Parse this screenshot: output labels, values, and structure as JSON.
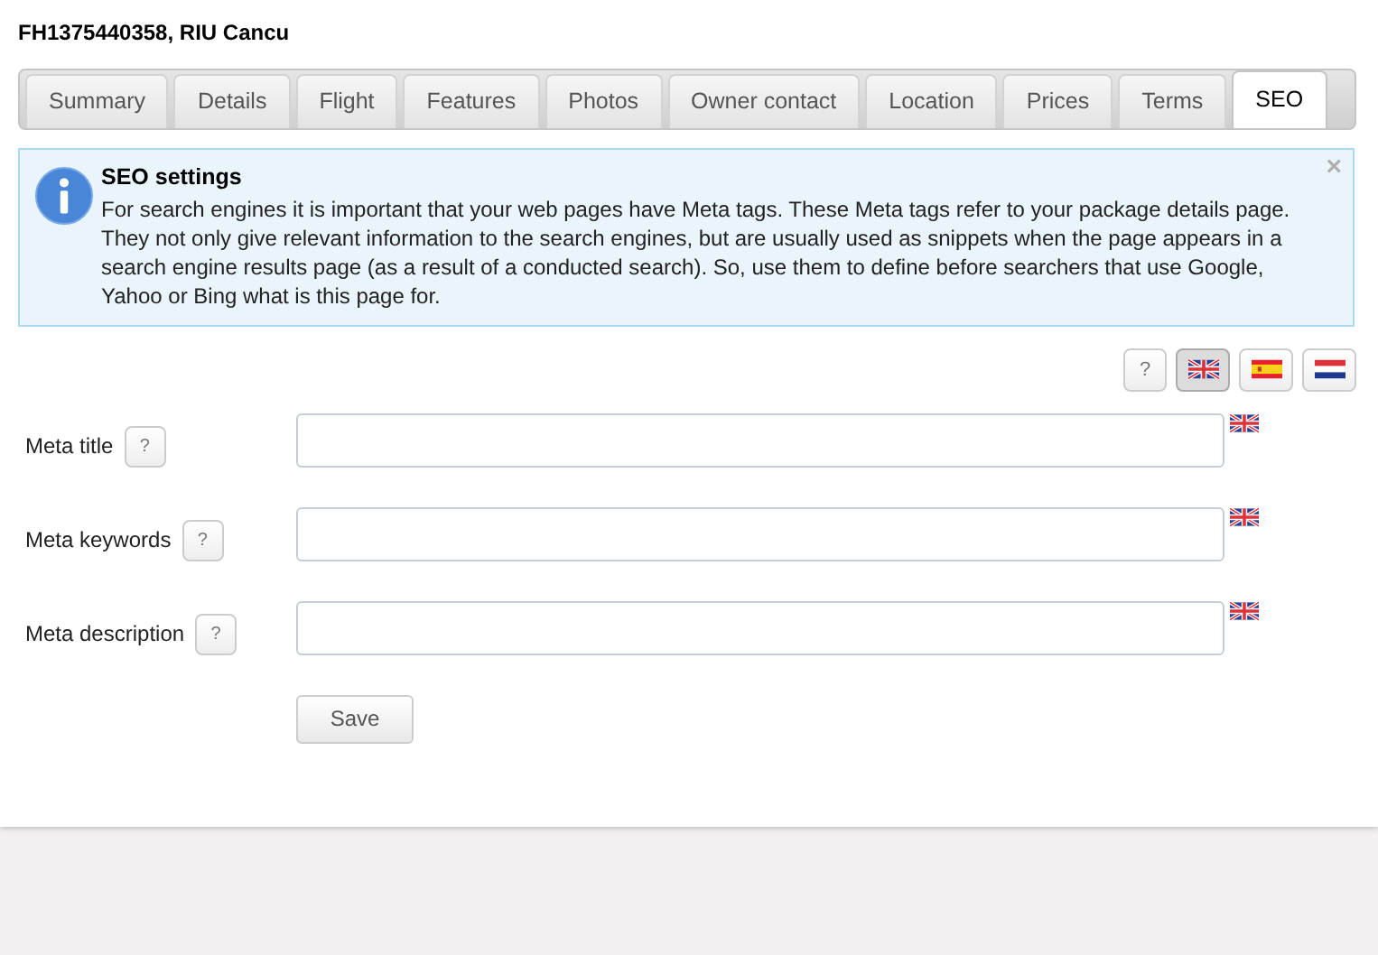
{
  "page_title": "FH1375440358, RIU Cancu",
  "tabs": [
    {
      "label": "Summary",
      "selected": false
    },
    {
      "label": "Details",
      "selected": false
    },
    {
      "label": "Flight",
      "selected": false
    },
    {
      "label": "Features",
      "selected": false
    },
    {
      "label": "Photos",
      "selected": false
    },
    {
      "label": "Owner contact",
      "selected": false
    },
    {
      "label": "Location",
      "selected": false
    },
    {
      "label": "Prices",
      "selected": false
    },
    {
      "label": "Terms",
      "selected": false
    },
    {
      "label": "SEO",
      "selected": true
    }
  ],
  "info": {
    "title": "SEO settings",
    "text": "For search engines it is important that your web pages have Meta tags. These Meta tags refer to your package details page. They not only give relevant information to the search engines, but are usually used as snippets when the page appears in a search engine results page (as a result of a conducted search). So, use them to define before searchers that use Google, Yahoo or Bing what is this page for.",
    "close": "×"
  },
  "help_label": "?",
  "languages": [
    {
      "kind": "uk",
      "selected": true
    },
    {
      "kind": "es",
      "selected": false
    },
    {
      "kind": "nl",
      "selected": false
    }
  ],
  "fields": [
    {
      "label": "Meta title",
      "help": "?",
      "flag": {
        "kind": "uk"
      }
    },
    {
      "label": "Meta keywords",
      "help": "?",
      "flag": {
        "kind": "uk"
      }
    },
    {
      "label": "Meta description",
      "help": "?",
      "flag": {
        "kind": "uk"
      }
    }
  ],
  "save_button": "Save"
}
